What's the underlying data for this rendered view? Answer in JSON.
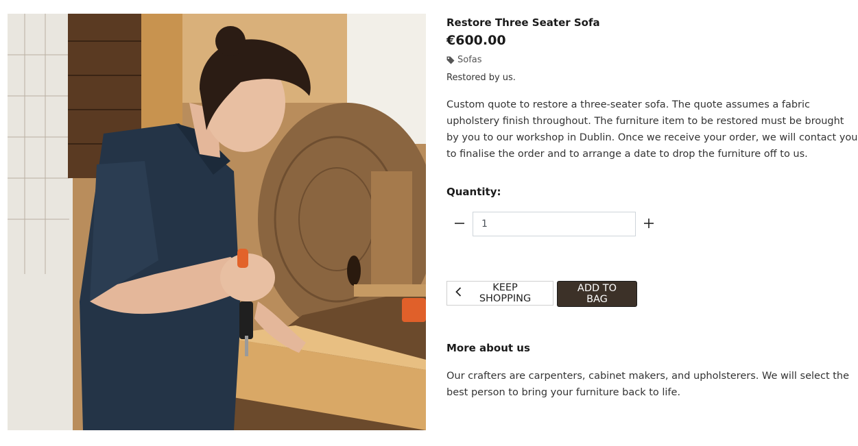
{
  "product": {
    "title": "Restore Three Seater Sofa",
    "price": "€600.00",
    "category": "Sofas",
    "category_icon": "tag-icon",
    "restored_by": "Restored by us.",
    "description": "Custom quote to restore a three-seater sofa. The quote assumes a fabric upholstery finish throughout. The furniture item to be restored must be brought by you to our workshop in Dublin. Once we receive your order, we will contact you to finalise the order and to arrange a date to drop the furniture off to us."
  },
  "quantity": {
    "label": "Quantity:",
    "value": "1",
    "decrement_icon": "minus-icon",
    "increment_icon": "plus-icon"
  },
  "actions": {
    "keep_shopping_label": "KEEP SHOPPING",
    "keep_shopping_icon": "chevron-left-icon",
    "add_to_bag_label": "ADD TO BAG"
  },
  "more_about": {
    "title": "More about us",
    "text": "Our crafters are carpenters, cabinet makers, and upholsterers. We will select the best person to bring your furniture back to life."
  },
  "colors": {
    "add_button_bg": "#3c3128",
    "text": "#333333",
    "border": "#cfcfcf"
  }
}
